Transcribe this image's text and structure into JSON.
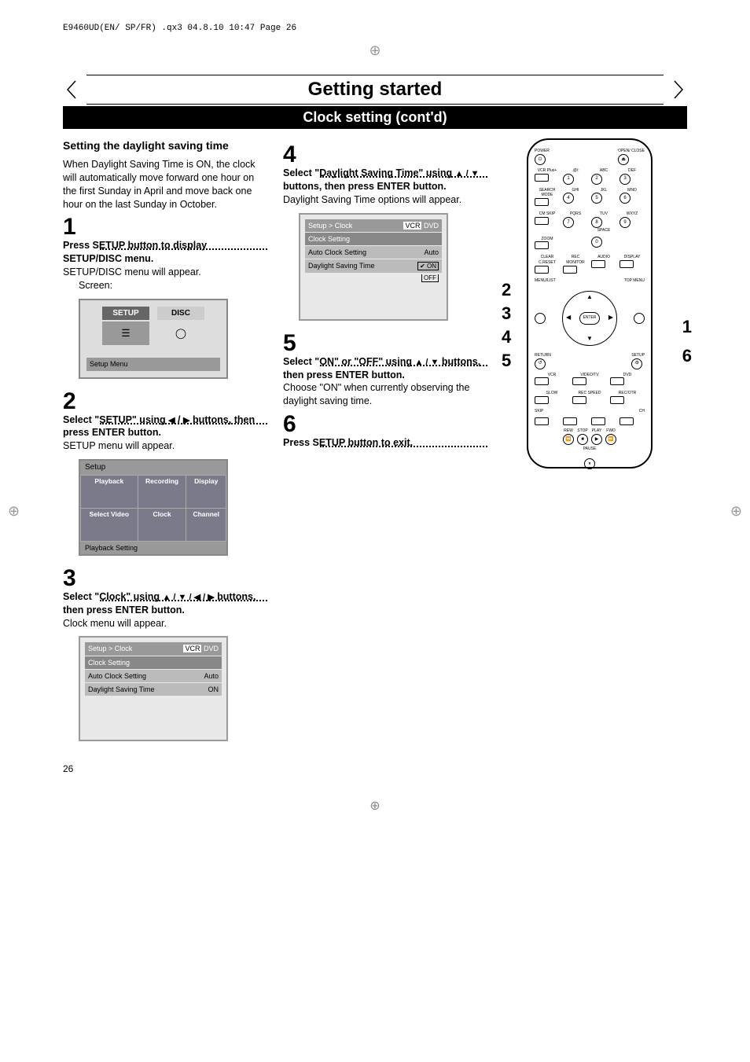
{
  "header_note": "E9460UD(EN/ SP/FR) .qx3  04.8.10  10:47  Page 26",
  "banner_title": "Getting started",
  "sub_banner": "Clock setting (cont'd)",
  "left": {
    "heading": "Setting the daylight saving time",
    "intro": "When Daylight Saving Time is ON, the clock will automatically move forward one hour on the first Sunday in April and move back one hour on the last Sunday in October.",
    "step1": {
      "num": "1",
      "bold": "Press SETUP button to display SETUP/DISC menu.",
      "text": "SETUP/DISC menu will appear.",
      "screen_label": "Screen:",
      "setup_label": "SETUP",
      "disc_label": "DISC",
      "footer": "Setup Menu"
    },
    "step2": {
      "num": "2",
      "bold_pre": "Select \"SETUP\" using ",
      "bold_mid": " / ",
      "bold_post": " buttons, then press ENTER button.",
      "text": "SETUP menu will appear.",
      "grid_title": "Setup",
      "grid": [
        "Playback",
        "Recording",
        "Display",
        "Select Video",
        "Clock",
        "Channel"
      ],
      "footer": "Playback Setting"
    },
    "step3": {
      "num": "3",
      "bold_pre": "Select \"Clock\" using ",
      "bold_post": " buttons, then press ENTER button.",
      "text": "Clock menu will appear.",
      "osd_title": "Setup > Clock",
      "badge1": "VCR",
      "badge2": "DVD",
      "rows": [
        {
          "l": "Clock Setting",
          "r": ""
        },
        {
          "l": "Auto Clock Setting",
          "r": "Auto"
        },
        {
          "l": "Daylight Saving Time",
          "r": "ON"
        }
      ]
    }
  },
  "mid": {
    "step4": {
      "num": "4",
      "bold_pre": "Select \"Daylight Saving Time\" using ",
      "bold_post": " buttons, then press ENTER button.",
      "text": "Daylight Saving Time options will appear.",
      "osd_title": "Setup > Clock",
      "badge1": "VCR",
      "badge2": "DVD",
      "rows": [
        {
          "l": "Clock Setting",
          "r": ""
        },
        {
          "l": "Auto Clock Setting",
          "r": "Auto"
        },
        {
          "l": "Daylight Saving Time",
          "r": ""
        }
      ],
      "opt_on": "ON",
      "opt_off": "OFF"
    },
    "step5": {
      "num": "5",
      "bold_pre": "Select \"ON\" or \"OFF\" using ",
      "bold_post": " buttons, then press ENTER button.",
      "text": "Choose \"ON\" when currently observing the daylight saving time."
    },
    "step6": {
      "num": "6",
      "bold": "Press SETUP button to exit."
    }
  },
  "remote": {
    "labels": {
      "power": "POWER",
      "open": "OPEN/ CLOSE",
      "vcrplus": "VCR Plus+",
      "at": ".@/:",
      "abc": "ABC",
      "def": "DEF",
      "search": "SEARCH MODE",
      "ghi": "GHI",
      "jkl": "JKL",
      "mno": "MNO",
      "cmskip": "CM SKIP",
      "pqrs": "PQRS",
      "space": "SPACE",
      "tuv": "TUV",
      "wxyz": "WXYZ",
      "zoom": "ZOOM",
      "clear": "CLEAR C.RESET",
      "rec": "REC MONITOR",
      "audio": "AUDIO",
      "display": "DISPLAY",
      "menulist": "MENU/LIST",
      "topmenu": "TOP MENU",
      "enter": "ENTER",
      "return": "RETURN",
      "setup": "SETUP",
      "vcr": "VCR",
      "videotv": "VIDEO/TV",
      "dvd": "DVD",
      "slow": "SLOW",
      "recspeed": "REC SPEED",
      "recotr": "REC/OTR",
      "skip": "SKIP",
      "ch": "CH",
      "rew": "REW",
      "stop": "STOP",
      "play": "PLAY",
      "fwd": "FWD",
      "pause": "PAUSE"
    },
    "nums": [
      "1",
      "2",
      "3",
      "4",
      "5",
      "6",
      "7",
      "8",
      "9",
      "0"
    ]
  },
  "callouts_left": [
    "2",
    "3",
    "4",
    "5"
  ],
  "callouts_right": [
    "1",
    "6"
  ],
  "page_number": "26"
}
